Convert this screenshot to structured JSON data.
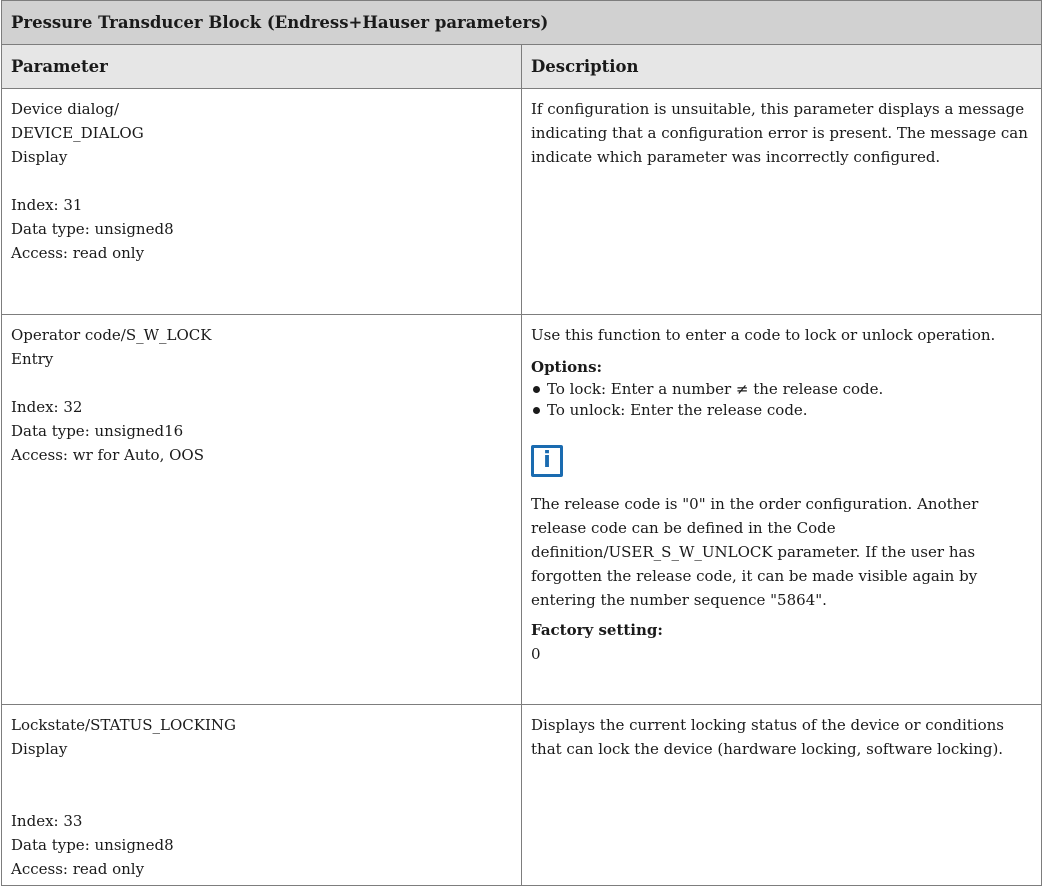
{
  "table_title": "Pressure Transducer Block (Endress+Hauser parameters)",
  "columns": [
    "Parameter",
    "Description"
  ],
  "rows": [
    {
      "param_lines_a": [
        "Device dialog/",
        "DEVICE_DIALOG",
        "Display"
      ],
      "param_lines_b": [
        "Index: 31",
        "Data type: unsigned8",
        "Access: read only"
      ],
      "description": "If configuration is unsuitable, this parameter displays a message indicating that a configuration error is present. The message can indicate which parameter was incorrectly configured."
    },
    {
      "param_lines_a": [
        "Operator code/S_W_LOCK",
        "Entry"
      ],
      "param_lines_b": [
        "Index: 32",
        "Data type: unsigned16",
        "Access: wr for Auto, OOS"
      ],
      "description": "Use this function to enter a code to lock or unlock operation.",
      "options_heading": "Options:",
      "options": [
        "To lock: Enter a number ≠ the release code.",
        "To unlock: Enter the release code."
      ],
      "info_icon": "info-icon",
      "info_text": "The release code is \"0\" in the order configuration. Another release code can be defined in the Code definition/USER_S_W_UNLOCK parameter. If the user has forgotten the release code, it can be made visible again by entering the number sequence \"5864\".",
      "factory_heading": "Factory setting:",
      "factory_value": "0"
    },
    {
      "param_lines_a": [
        "Lockstate/STATUS_LOCKING",
        "Display"
      ],
      "param_lines_b": [
        "Index: 33",
        "Data type: unsigned8",
        "Access: read only"
      ],
      "description": "Displays the current locking status of the device or conditions that can lock the device (hardware locking, software locking)."
    }
  ],
  "colors": {
    "title_bg": "#d1d1d1",
    "header_bg": "#e6e6e6",
    "border": "#7d7d7d",
    "info_icon": "#1a6bb0"
  }
}
